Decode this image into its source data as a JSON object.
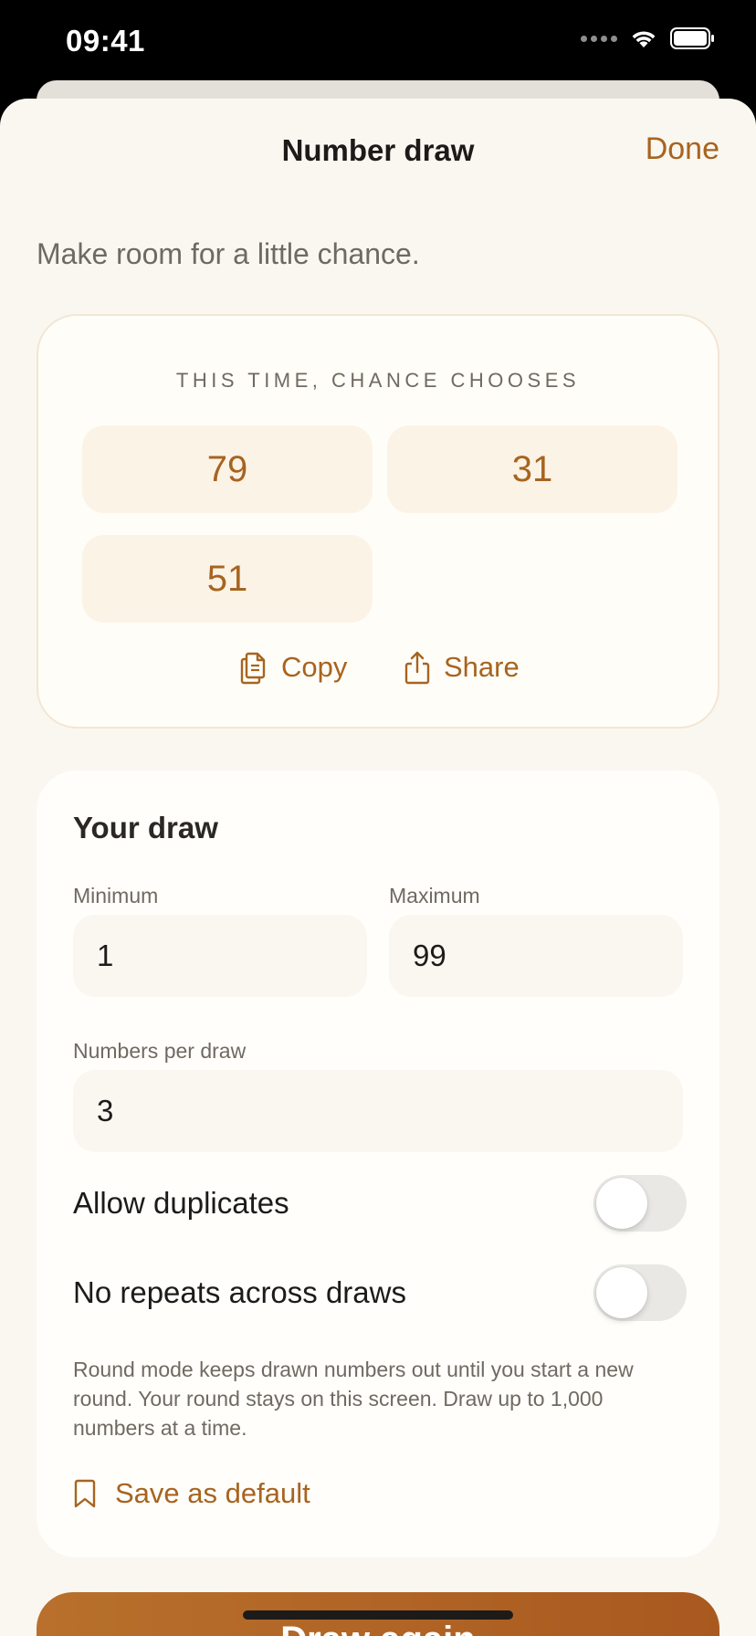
{
  "status_bar": {
    "time": "09:41"
  },
  "nav": {
    "title": "Number draw",
    "done_label": "Done"
  },
  "tagline": "Make room for a little chance.",
  "result": {
    "header": "THIS TIME, CHANCE CHOOSES",
    "numbers": [
      "79",
      "31",
      "51"
    ],
    "copy_label": "Copy",
    "share_label": "Share"
  },
  "form": {
    "title": "Your draw",
    "minimum": {
      "label": "Minimum",
      "value": "1"
    },
    "maximum": {
      "label": "Maximum",
      "value": "99"
    },
    "per_draw": {
      "label": "Numbers per draw",
      "value": "3"
    },
    "allow_duplicates": {
      "label": "Allow duplicates",
      "on": false
    },
    "no_repeats": {
      "label": "No repeats across draws",
      "on": false
    },
    "help": "Round mode keeps drawn numbers out until you start a new round. Your round stays on this screen. Draw up to 1,000 numbers at a time.",
    "save_default_label": "Save as default"
  },
  "draw_button": {
    "label": "Draw again"
  },
  "colors": {
    "accent": "#a7641f",
    "sheet_bg": "#faf7f1",
    "chip_bg": "#fcf3e7"
  }
}
